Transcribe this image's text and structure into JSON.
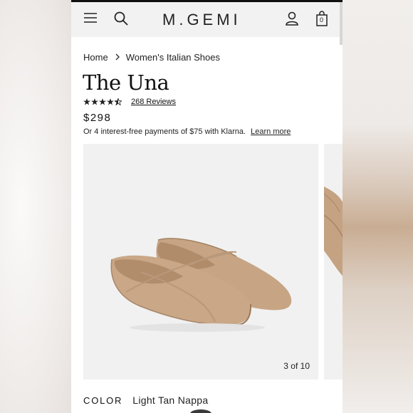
{
  "header": {
    "logo": "M.GEMI",
    "menu_icon": "hamburger-menu-icon",
    "search_icon": "search-icon",
    "account_icon": "user-icon",
    "cart_icon": "shopping-bag-icon",
    "cart_count": "0"
  },
  "breadcrumb": {
    "items": [
      "Home",
      "Women's Italian Shoes"
    ],
    "separator_icon": "chevron-right-icon"
  },
  "product": {
    "title": "The Una",
    "rating": 4.5,
    "reviews_label": "268 Reviews",
    "price": "$298",
    "installments_text": "Or 4 interest-free payments of $75 with Klarna.",
    "installments_link": "Learn more"
  },
  "gallery": {
    "counter": "3 of 10"
  },
  "color": {
    "label": "COLOR",
    "value": "Light Tan Nappa"
  },
  "colors": {
    "shoe": "#c4a282",
    "shoe_shadow": "#a88566",
    "image_bg": "#f1f1f1"
  }
}
